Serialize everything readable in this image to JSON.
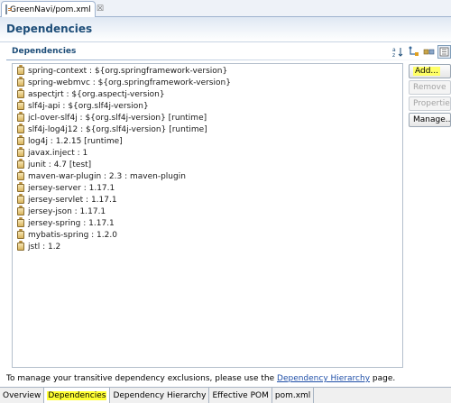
{
  "editor_tab": {
    "label": "GreenNavi/pom.xml",
    "close": "☒"
  },
  "page_title": "Dependencies",
  "section_title": "Dependencies",
  "toolbar": {
    "icons": [
      "sort-alphabetical-icon",
      "show-groupid-icon",
      "filter-icon",
      "collapse-icon"
    ]
  },
  "dependencies": [
    "spring-context : ${org.springframework-version}",
    "spring-webmvc : ${org.springframework-version}",
    "aspectjrt : ${org.aspectj-version}",
    "slf4j-api : ${org.slf4j-version}",
    "jcl-over-slf4j : ${org.slf4j-version} [runtime]",
    "slf4j-log4j12 : ${org.slf4j-version} [runtime]",
    "log4j : 1.2.15 [runtime]",
    "javax.inject : 1",
    "junit : 4.7 [test]",
    "maven-war-plugin : 2.3 : maven-plugin",
    "jersey-server : 1.17.1",
    "jersey-servlet : 1.17.1",
    "jersey-json : 1.17.1",
    "jersey-spring : 1.17.1",
    "mybatis-spring : 1.2.0",
    "jstl : 1.2"
  ],
  "buttons": {
    "add": "Add...",
    "remove": "Remove",
    "properties": "Properties...",
    "manage": "Manage..."
  },
  "footer": {
    "prefix": "To manage your transitive dependency exclusions, please use the ",
    "link": "Dependency Hierarchy",
    "suffix": " page."
  },
  "bottom_tabs": [
    "Overview",
    "Dependencies",
    "Dependency Hierarchy",
    "Effective POM",
    "pom.xml"
  ],
  "highlight_color": "#ffff33"
}
